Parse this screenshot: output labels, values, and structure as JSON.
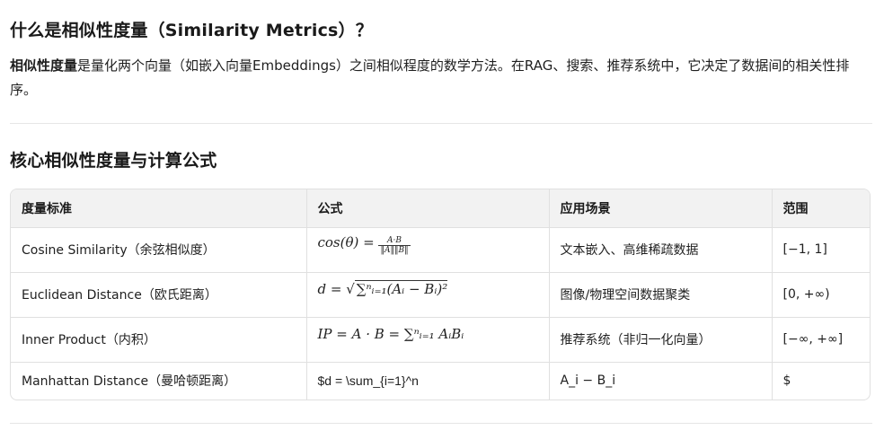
{
  "section1": {
    "title": "什么是相似性度量（Similarity Metrics）？",
    "intro_bold": "相似性度量",
    "intro_rest": "是量化两个向量（如嵌入向量Embeddings）之间相似程度的数学方法。在RAG、搜索、推荐系统中，它决定了数据间的相关性排序。"
  },
  "section2": {
    "title": "核心相似性度量与计算公式"
  },
  "table": {
    "headers": [
      "度量标准",
      "公式",
      "应用场景",
      "范围"
    ],
    "rows": [
      {
        "metric": "Cosine Similarity（余弦相似度）",
        "formula_lhs": "cos(θ) = ",
        "formula_num": "A·B",
        "formula_den": "‖A‖‖B‖",
        "use_case": "文本嵌入、高维稀疏数据",
        "range": "[−1, 1]"
      },
      {
        "metric": "Euclidean Distance（欧氏距离）",
        "formula_lhs": "d = √",
        "formula_body": "∑ⁿᵢ₌₁(Aᵢ − Bᵢ)²",
        "use_case": "图像/物理空间数据聚类",
        "range": "[0, +∞)"
      },
      {
        "metric": "Inner Product（内积）",
        "formula": "IP = A · B = ∑ⁿᵢ₌₁ AᵢBᵢ",
        "use_case": "推荐系统（非归一化向量）",
        "range": "[−∞, +∞]"
      },
      {
        "metric": "Manhattan Distance（曼哈顿距离）",
        "formula_raw": "$d = \\sum_{i=1}^n",
        "use_case": "A_i − B_i",
        "range": "$"
      }
    ]
  }
}
